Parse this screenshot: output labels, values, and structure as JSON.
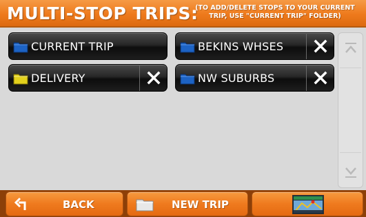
{
  "header": {
    "title": "MULTI-STOP TRIPS:",
    "hint_line1": "(TO ADD/DELETE STOPS TO YOUR CURRENT",
    "hint_line2": "TRIP, USE \"CURRENT TRIP\" FOLDER)"
  },
  "trips": [
    {
      "label": "CURRENT TRIP",
      "folder_color": "#1d63c4",
      "deletable": false
    },
    {
      "label": "BEKINS WHSES",
      "folder_color": "#1d63c4",
      "deletable": true
    },
    {
      "label": "DELIVERY",
      "folder_color": "#e3d11c",
      "deletable": true
    },
    {
      "label": "NW SUBURBS",
      "folder_color": "#1d63c4",
      "deletable": true
    }
  ],
  "bottom_bar": {
    "back_label": "BACK",
    "new_trip_label": "NEW TRIP",
    "back_icon": "back-arrow-icon",
    "new_trip_icon": "folder-icon",
    "map_icon": "map-thumbnail-icon"
  },
  "colors": {
    "accent_orange": "#ef7a1e",
    "button_dark": "#1d1d1d",
    "background": "#d9d9d9"
  }
}
